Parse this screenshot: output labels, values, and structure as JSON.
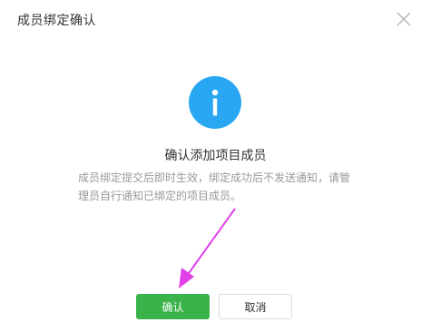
{
  "colors": {
    "accent": "#2aa7f2",
    "confirm": "#3ab34a",
    "annotation_arrow": "#e040e8"
  },
  "dialog": {
    "title": "成员绑定确认",
    "close_icon": "close-icon",
    "status_icon": "info-icon",
    "heading": "确认添加项目成员",
    "description": "成员绑定提交后即时生效，绑定成功后不发送通知，请管理员自行通知已绑定的项目成员。",
    "confirm_label": "确认",
    "cancel_label": "取消"
  }
}
